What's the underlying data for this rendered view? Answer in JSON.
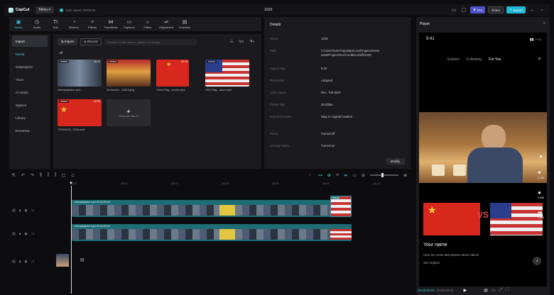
{
  "app": {
    "name": "CapCut",
    "menu": "Menu",
    "save_status": "Auto saved: 00:00:30",
    "project_title": "1029"
  },
  "topbar": {
    "pro": "Pro",
    "share": "Share",
    "export": "Export"
  },
  "tools": [
    {
      "label": "Media",
      "icon": "media-icon",
      "glyph": "▣"
    },
    {
      "label": "Audio",
      "icon": "audio-icon",
      "glyph": "◷"
    },
    {
      "label": "Text",
      "icon": "text-icon",
      "glyph": "TI"
    },
    {
      "label": "Stickers",
      "icon": "sticker-icon",
      "glyph": "◔"
    },
    {
      "label": "Effects",
      "icon": "effects-icon",
      "glyph": "✧"
    },
    {
      "label": "Transitions",
      "icon": "transition-icon",
      "glyph": "⋈"
    },
    {
      "label": "Captions",
      "icon": "captions-icon",
      "glyph": "▭"
    },
    {
      "label": "Filters",
      "icon": "filter-icon",
      "glyph": "⌂"
    },
    {
      "label": "Adjustment",
      "icon": "adjust-icon",
      "glyph": "⇌"
    },
    {
      "label": "AI avatar",
      "icon": "avatar-icon",
      "glyph": "▤"
    }
  ],
  "sidenav": [
    "Import",
    "Media",
    "Subprojects",
    "Yours",
    "AI media",
    "Spaces",
    "Library",
    "Dreamina"
  ],
  "media": {
    "import": "Import",
    "record": "Record",
    "search_placeholder": "Search for file names, scenes, or dialogs",
    "all": "All",
    "items": [
      {
        "name": "videoplayback.mp4",
        "badge": "Added",
        "dur": "00:12"
      },
      {
        "name": "Screensho...43513.png",
        "badge": "Added",
        "dur": ""
      },
      {
        "name": "China Flag...shorts.mp4",
        "badge": "",
        "dur": "00:15"
      },
      {
        "name": "USA Flag....ation.mp4",
        "badge": "Added",
        "dur": ""
      },
      {
        "name": "TONGKOK_TION.mp4",
        "badge": "Added",
        "dur": "02:00"
      }
    ],
    "generate": "Generate with AI"
  },
  "details": {
    "title": "Details",
    "rows": [
      {
        "k": "Name",
        "v": "1029"
      },
      {
        "k": "Path",
        "v": "C:\\Users\\User\\AppData\\Local\\CapCut\\User Data\\Projects\\com.lveditor.draft\\1029"
      },
      {
        "k": "Aspect ratio",
        "v": "9:16"
      },
      {
        "k": "Resolution",
        "v": "Adapted"
      },
      {
        "k": "Color space",
        "v": "Rec. 709 SDR"
      },
      {
        "k": "Frame rate",
        "v": "30.00fps"
      },
      {
        "k": "Imported media",
        "v": "Stay in original location"
      },
      {
        "k": "Proxy",
        "v": "Turned off"
      },
      {
        "k": "Arrange layers",
        "v": "Turned on"
      }
    ],
    "modify": "Modify"
  },
  "player": {
    "title": "Player",
    "time": "9:41",
    "tabs": [
      "Explore",
      "Following",
      "For You"
    ],
    "vs": "VS",
    "counts": [
      "2.8M",
      "2.8M",
      "2.8M"
    ],
    "username": "Your name",
    "desc": "Here are some descriptions about videos",
    "see": "See original",
    "cur_time": "00:00:00:00",
    "total_time": "00:00:35:00"
  },
  "timeline": {
    "ticks": [
      "00:00",
      "|00:10",
      "|00:20",
      "|00:30",
      "|00:40",
      "|00:50",
      "|01:00"
    ],
    "clip_label": "videoplayback.mp4  00:00:50:00",
    "clip_label2": "videoplayback.mp4  00:00:50:00",
    "end_label": "videopl"
  },
  "colors": {
    "accent": "#1fb6d8",
    "teal_clip": "#1e6d75",
    "pro": "#4f53c7"
  }
}
